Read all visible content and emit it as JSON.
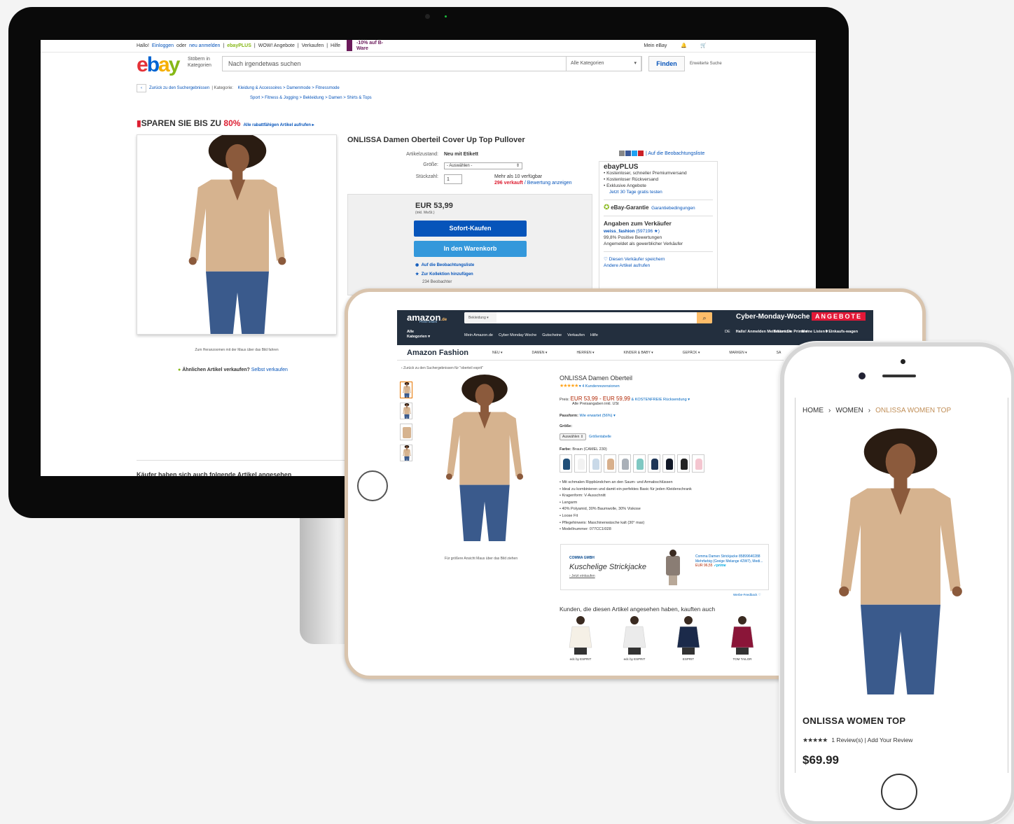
{
  "ebay": {
    "topbar": {
      "hallo": "Hallo!",
      "einloggen": "Einloggen",
      "oder": "oder",
      "neu": "neu anmelden",
      "plus": "ebayPLUS",
      "wow": "WOW! Angebote",
      "verkaufen": "Verkaufen",
      "hilfe": "Hilfe",
      "promo": "-10% auf B-Ware",
      "mein": "Mein eBay"
    },
    "header": {
      "browse": "Stöbern in Kategorien",
      "search_placeholder": "Nach irgendetwas suchen",
      "category": "Alle Kategorien",
      "find": "Finden",
      "advanced": "Erweiterte Suche"
    },
    "breadcrumb": {
      "back": "Zurück zu den Suchergebnissen",
      "label": "Kategorie:",
      "line1": "Kleidung & Accessoires > Damenmode > Fitnessmode",
      "line2": "Sport > Fitness & Jogging > Bekleidung > Damen > Shirts & Tops"
    },
    "sparen": {
      "text": "SPAREN SIE BIS ZU",
      "pct": "80%",
      "link": "Alle rabattfähigen Artikel aufrufen ▸"
    },
    "zoom_hint": "Zum Heranzoomen mit der Maus über das Bild fahren",
    "aehnlich": {
      "text": "Ähnlichen Artikel verkaufen?",
      "link": "Selbst verkaufen"
    },
    "title": "ONLISSA Damen Oberteil Cover Up Top Pullover",
    "rows": {
      "zustand_k": "Artikelzustand:",
      "zustand_v": "Neu mit Etikett",
      "groesse_k": "Größe:",
      "groesse_v": "- Auswählen -",
      "stueck_k": "Stückzahl:",
      "stueck_v": "1",
      "avail": "Mehr als 10 verfügbar",
      "sold": "296 verkauft",
      "rate": "/ Bewertung anzeigen"
    },
    "buy": {
      "price": "EUR 53,99",
      "inkl": "(inkl. MwSt.)",
      "sofort": "Sofort-Kaufen",
      "warenkorb": "In den Warenkorb",
      "beobachtung": "Auf die Beobachtungsliste",
      "kollektion": "Zur Kollektion hinzufügen",
      "beobachter": "234 Beobachter"
    },
    "right": {
      "share": "| Auf die Beobachtungsliste",
      "plus_title": "ebayPLUS",
      "plus_items": [
        "Kostenloser, schneller Premiumversand",
        "Kostenloser Rückversand",
        "Exklusive Angebote"
      ],
      "plus_link": "Jetzt 30 Tage gratis testen",
      "garantie": "eBay-Garantie",
      "garantie_link": "Garantiebedingungen",
      "seller_h": "Angaben zum Verkäufer",
      "seller": "weiss_fashion",
      "seller_n": "(597196 ★)",
      "positiv": "99,8% Positive Bewertungen",
      "gewerb": "Angemeldet als gewerblicher Verkäufer",
      "save": "♡ Diesen Verkäufer speichern",
      "andere": "Andere Artikel aufrufen"
    },
    "also": "Käufer haben sich auch folgende Artikel angesehen"
  },
  "amazon": {
    "logo": "amazon",
    "logo_tld": ".de",
    "prime_test": "Prime testen",
    "search_cat": "Bekleidung ▾",
    "cyber": "Cyber-Monday-Woche",
    "angebote": "ANGEBOTE",
    "all_cat": "Alle Kategorien ▾",
    "nav": [
      "Mein Amazon.de",
      "Cyber Monday Woche",
      "Gutscheine",
      "Verkaufen",
      "Hilfe"
    ],
    "acc": [
      "DE",
      "Hallo! Anmelden Mein Konto ▾",
      "Testen Sie Prime ▾",
      "Meine Listen ▾",
      "0 Einkaufs-wagen"
    ],
    "fashion": "Amazon Fashion",
    "fnav": [
      "NEU ▾",
      "DAMEN ▾",
      "HERREN ▾",
      "KINDER & BABY ▾",
      "GEPÄCK ▾",
      "MARKEN ▾",
      "SA"
    ],
    "back": "‹ Zurück zu den Suchergebnissen für \"oberteil esprit\"",
    "img_hint": "Für größere Ansicht Maus über das Bild ziehen",
    "title": "ONLISSA Damen Oberteil",
    "stars": "★★★★★",
    "reviews": "▾    4 Kundenrezensionen",
    "price_label": "Preis:",
    "price": "EUR 53,99 - EUR 59,99",
    "shipping": "& KOSTENFREIE Rücksendung ▾",
    "price_note": "Alle Preisangaben inkl. USt",
    "fit_label": "Passform:",
    "fit": "Wie erwartet (56%) ▾",
    "size_label": "Größe:",
    "size_sel": "Auswählen ⇕",
    "size_chart": "Größentabelle",
    "color_label": "Farbe:",
    "color": "Braun (CAMEL 230)",
    "swatch_colors": [
      "#1f4e78",
      "#f2f2f2",
      "#c9d9e8",
      "#d8b08c",
      "#a9b0b8",
      "#7fc8c2",
      "#1d3557",
      "#111827",
      "#222",
      "#f4c6d0"
    ],
    "bullets": [
      "Mit schmalen Rippbündchen an den Saum- und Armabschlüssen",
      "Ideal zu kombinieren und damit ein perfektes Basic für jeden Kleiderschrank",
      "Kragenform: V-Ausschnitt",
      "Langarm",
      "40% Polyamid, 30% Baumwolle, 30% Viskose",
      "Loose Fit",
      "Pflegehinweis: Maschinenwäsche kalt (30° max)",
      "Modellnummer: 077CC1I028"
    ],
    "ad": {
      "company": "COMMA GMBH",
      "headline": "Kuschelige Strickjacke",
      "cta": "› Jetzt einkaufen",
      "desc": "Comma Damen Strickjacke 85899640288 Mehrfarbig (Greige Melange 42W7), Medi...",
      "price": "EUR 96,55",
      "prime": "✓prime"
    },
    "feedback": "Werbe-Feedback ♡",
    "also_h": "Kunden, die diesen Artikel angesehen haben, kauften auch",
    "recs": [
      {
        "name": "edc by ESPRIT",
        "color": "#f5f0e6"
      },
      {
        "name": "edc by ESPRIT",
        "color": "#ebebeb"
      },
      {
        "name": "ESPRIT",
        "color": "#1b2a4a"
      },
      {
        "name": "TOM TAILOR",
        "color": "#8a1538"
      }
    ]
  },
  "phone": {
    "bc": [
      "HOME",
      "WOMEN",
      "ONLISSA WOMEN TOP"
    ],
    "title": "ONLISSA WOMEN TOP",
    "stars": "★★★★★",
    "review": "1 Review(s)  |  Add Your Review",
    "price": "$69.99"
  }
}
